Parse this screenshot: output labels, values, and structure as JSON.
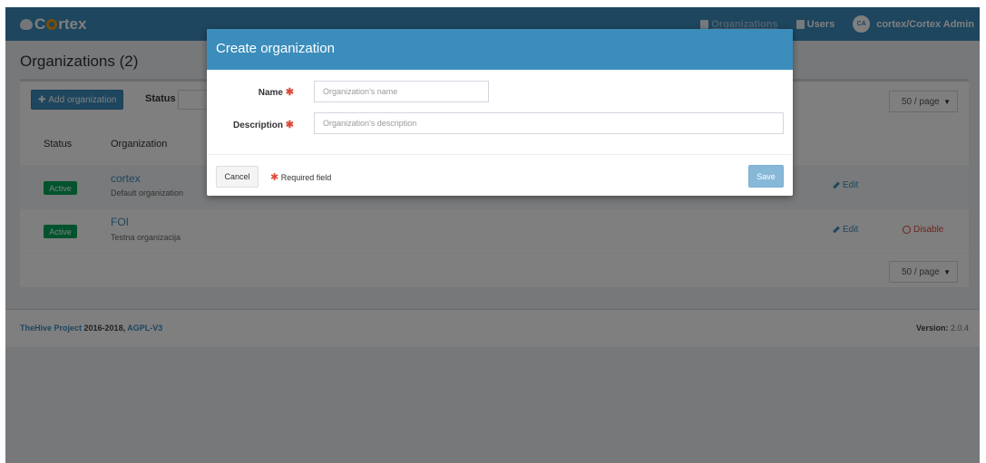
{
  "navbar": {
    "brand_prefix": "C",
    "brand_suffix": "rtex",
    "organizations": "Organizations",
    "users": "Users",
    "avatar_initials": "CA",
    "user_label": "cortex/Cortex Admin"
  },
  "page": {
    "title": "Organizations (2)"
  },
  "toolbar": {
    "add_label": "Add organization",
    "status_label": "Status",
    "page_size": "50 / page"
  },
  "table": {
    "headers": {
      "status": "Status",
      "organization": "Organization"
    },
    "rows": [
      {
        "status": "Active",
        "name": "cortex",
        "description": "Default organization",
        "edit": "Edit",
        "disable": ""
      },
      {
        "status": "Active",
        "name": "FOI",
        "description": "Testna organizacija",
        "edit": "Edit",
        "disable": "Disable"
      }
    ]
  },
  "footer": {
    "project": "TheHive Project",
    "years": " 2016-2018, ",
    "license": "AGPL-V3",
    "version_label": "Version:",
    "version_value": " 2.0.4"
  },
  "modal": {
    "title": "Create organization",
    "name_label": "Name",
    "name_placeholder": "Organization's name",
    "description_label": "Description",
    "description_placeholder": "Organization's description",
    "required_star": "✱",
    "cancel_label": "Cancel",
    "required_note": "Required field",
    "save_label": "Save"
  },
  "colors": {
    "primary": "#3c8dbc",
    "success": "#00a65a",
    "danger": "#dd4b39",
    "brand_accent": "#f39c12"
  }
}
